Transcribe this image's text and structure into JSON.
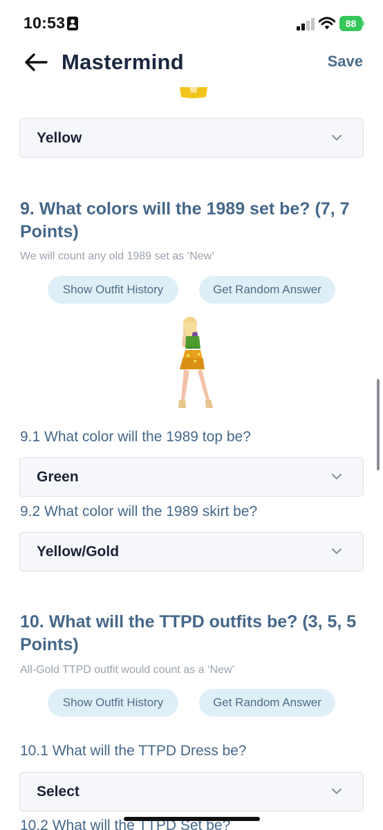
{
  "status_bar": {
    "time": "10:53",
    "battery": "88"
  },
  "nav": {
    "title": "Mastermind",
    "save_label": "Save"
  },
  "answer_8_selected": "Yellow",
  "q9": {
    "title": "9. What colors will the 1989 set be? (7, 7 Points)",
    "note": "We will count any old 1989 set as ‘New’",
    "buttons": {
      "history": "Show Outfit History",
      "random": "Get Random Answer"
    },
    "sub": [
      {
        "question": "9.1 What color will the 1989 top be?",
        "selected": "Green"
      },
      {
        "question": "9.2 What color will the 1989 skirt be?",
        "selected": "Yellow/Gold"
      }
    ]
  },
  "q10": {
    "title": "10. What will the TTPD outfits be? (3, 5, 5 Points)",
    "note": "All-Gold TTPD outfit would count as a ‘New’",
    "buttons": {
      "history": "Show Outfit History",
      "random": "Get Random Answer"
    },
    "sub": [
      {
        "question": "10.1 What will the TTPD Dress be?",
        "selected": "Select"
      },
      {
        "question": "10.2 What will the TTPD Set be?"
      }
    ]
  },
  "colors": {
    "accent": "#45678a",
    "pill_bg": "#dfeff7",
    "battery": "#34c759"
  }
}
